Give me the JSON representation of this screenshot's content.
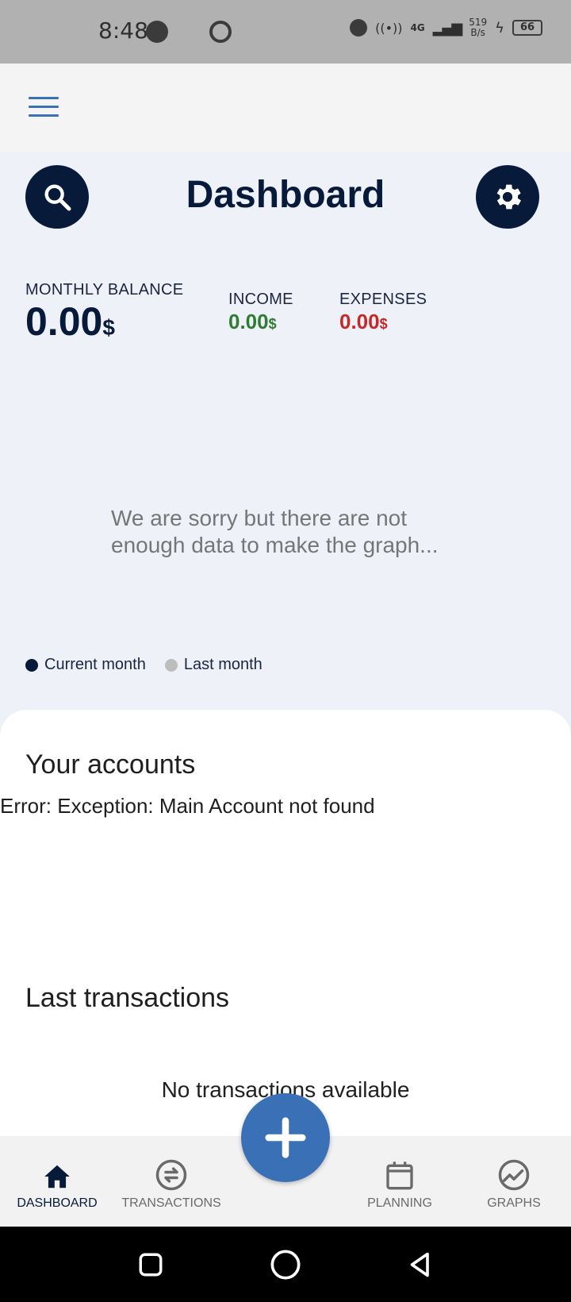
{
  "status_bar": {
    "time": "8:48",
    "network_type": "4G",
    "net_speed_value": "519",
    "net_speed_unit": "B/s",
    "battery": "66"
  },
  "header": {
    "title": "Dashboard"
  },
  "balance": {
    "monthly_label": "MONTHLY BALANCE",
    "monthly_value": "0.00",
    "income_label": "INCOME",
    "income_value": "0.00",
    "expenses_label": "EXPENSES",
    "expenses_value": "0.00",
    "currency": "$"
  },
  "graph": {
    "empty_message": "We are sorry but there are not enough data to make the graph...",
    "legend_current": "Current month",
    "legend_last": "Last month"
  },
  "accounts": {
    "title": "Your accounts",
    "error": "Error: Exception: Main Account not found"
  },
  "transactions": {
    "title": "Last transactions",
    "empty": "No transactions available"
  },
  "bottom_nav": {
    "items": [
      {
        "label": "DASHBOARD",
        "icon": "home-icon"
      },
      {
        "label": "TRANSACTIONS",
        "icon": "swap-icon"
      },
      {
        "label": "PLANNING",
        "icon": "calendar-icon"
      },
      {
        "label": "GRAPHS",
        "icon": "chart-icon"
      }
    ]
  },
  "colors": {
    "primary_dark": "#071a3a",
    "accent_blue": "#3a70b6",
    "income_green": "#2e7d32",
    "expenses_red": "#c62828",
    "legend_last_gray": "#bdbdbd"
  }
}
